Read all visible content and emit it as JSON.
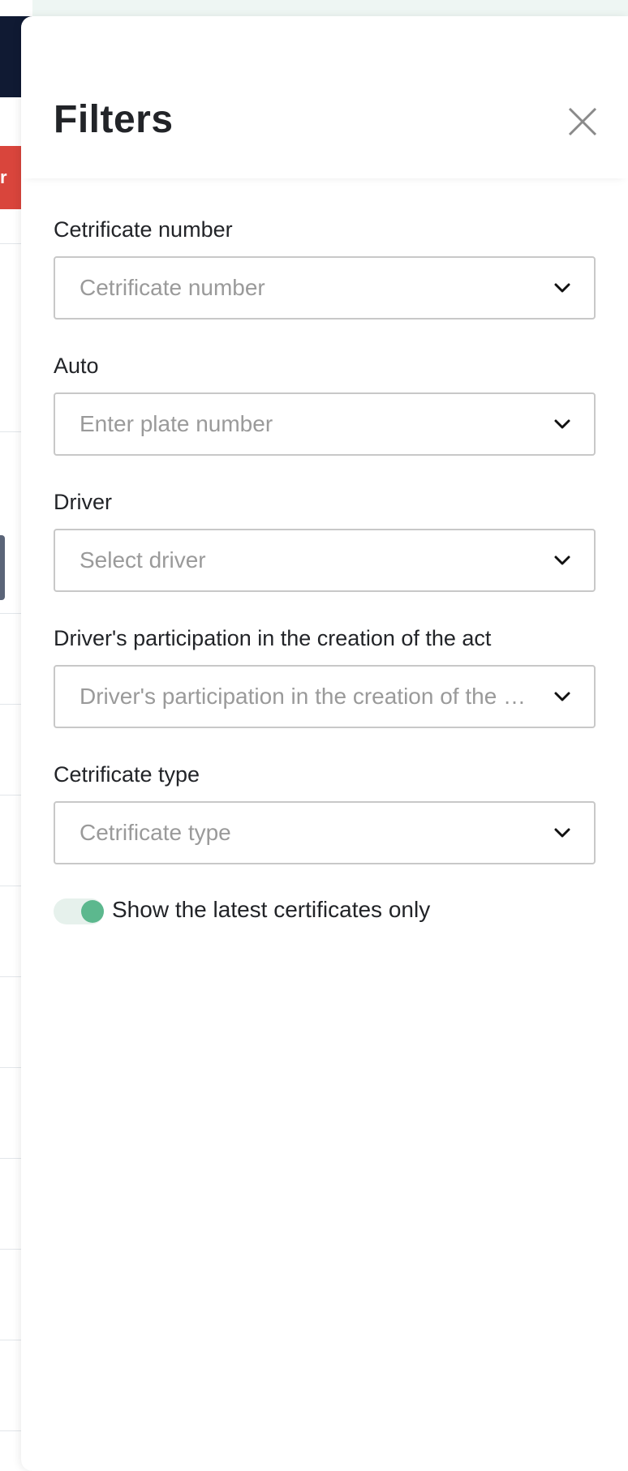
{
  "drawer": {
    "title": "Filters",
    "close_icon": "close-icon"
  },
  "filters": {
    "certificate_number": {
      "label": "Cetrificate number",
      "placeholder": "Cetrificate number"
    },
    "auto": {
      "label": "Auto",
      "placeholder": "Enter plate number"
    },
    "driver": {
      "label": "Driver",
      "placeholder": "Select driver"
    },
    "participation": {
      "label": "Driver's participation in the creation of the act",
      "placeholder": "Driver's participation in the creation of the act"
    },
    "certificate_type": {
      "label": "Cetrificate type",
      "placeholder": "Cetrificate type"
    }
  },
  "toggle": {
    "label": "Show the latest certificates only",
    "checked": true,
    "accent_color": "#5cb88e"
  },
  "background": {
    "badge_text": "r"
  }
}
